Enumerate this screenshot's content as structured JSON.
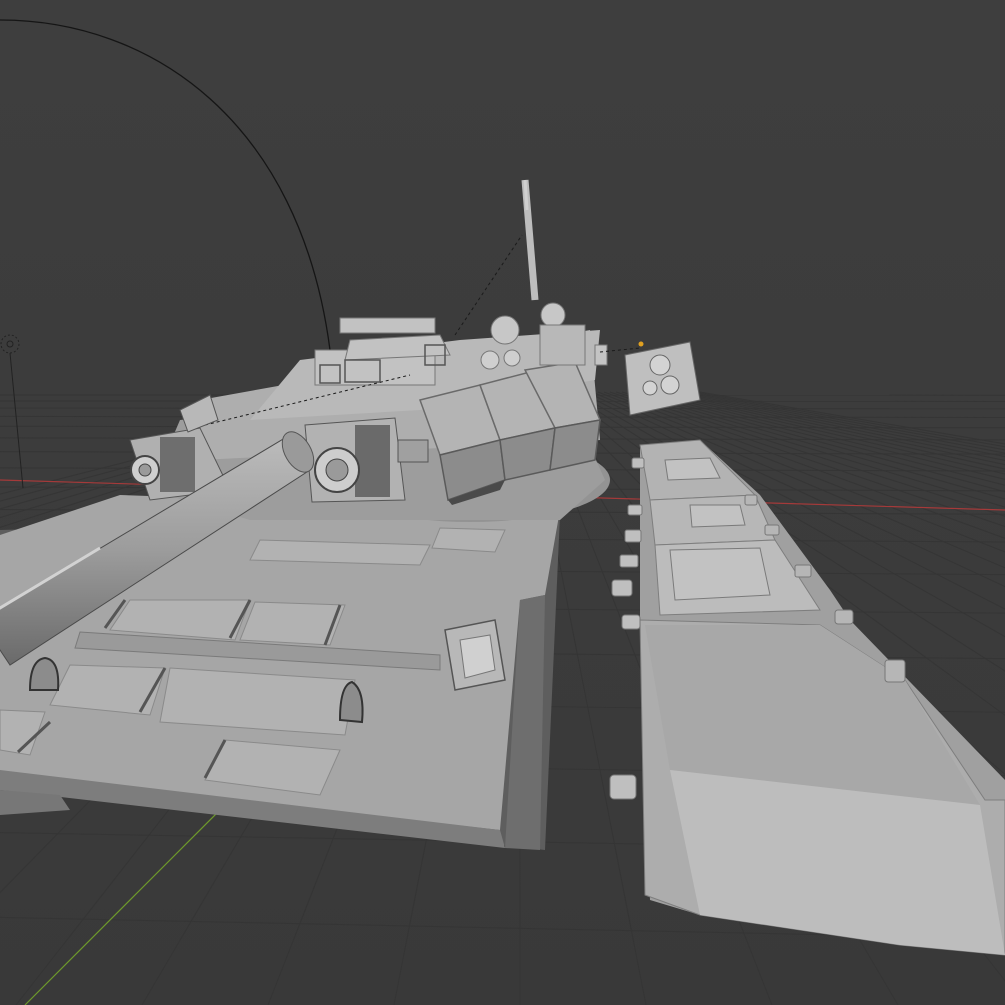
{
  "viewport": {
    "background_color": "#3d3d3d",
    "grid_color": "#353535",
    "x_axis_color": "#a53a3a",
    "y_axis_color": "#6e9a2c",
    "mesh_color": "#a4a4a4",
    "shadow_color": "#5e5e5e"
  },
  "objects": {
    "light_icon": "light-icon",
    "camera_icon": "camera-icon",
    "origin_icon": "origin-point-icon",
    "mesh_name": "tank-model"
  }
}
